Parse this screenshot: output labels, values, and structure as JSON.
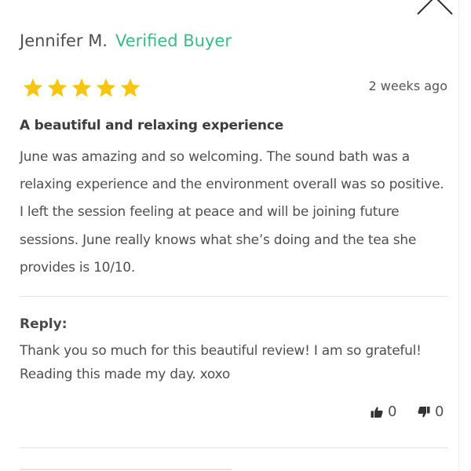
{
  "review": {
    "reviewer_name": "Jennifer M.",
    "verified_label": "Verified Buyer",
    "rating": 5,
    "max_rating": 5,
    "date": "2 weeks ago",
    "title": "A beautiful and relaxing experience",
    "body": "June was amazing and so welcoming. The sound bath was a relaxing experience and the environment overall was so positive. I left the session feeling at peace and will be joining future sessions. June really knows what she’s doing and the tea she provides is 10/10."
  },
  "reply": {
    "label": "Reply:",
    "body": "Thank you so much for this beautiful review! I am so grateful! Reading this made my day. xoxo"
  },
  "votes": {
    "up_count": "0",
    "down_count": "0"
  },
  "icons": {
    "close": "close-icon",
    "star": "star-icon",
    "thumbs_up": "thumbs-up-icon",
    "thumbs_down": "thumbs-down-icon"
  },
  "colors": {
    "star": "#f6c50f",
    "verified": "#3cba84",
    "text": "#4f4f4f"
  }
}
